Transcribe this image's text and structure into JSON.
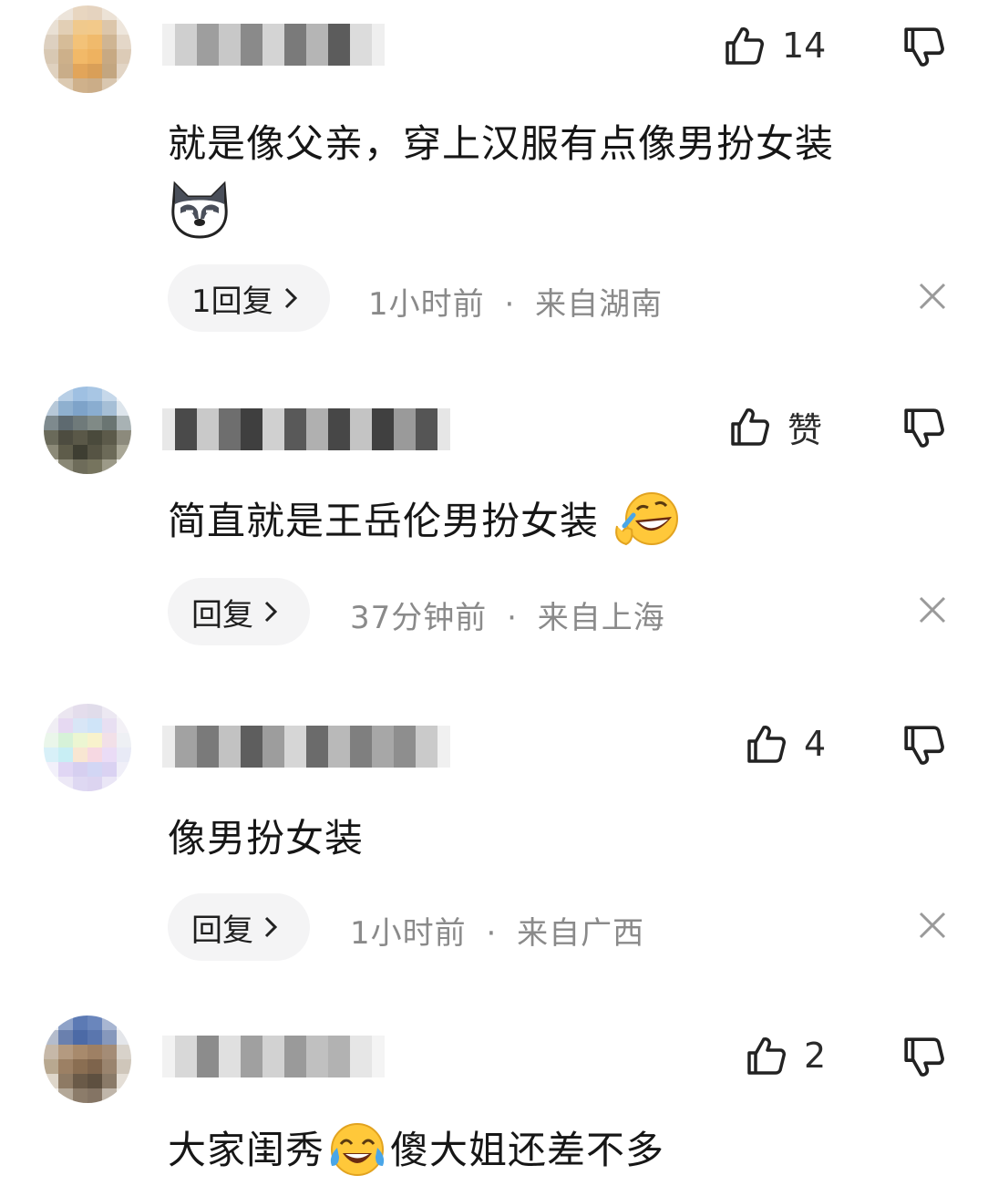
{
  "comments": [
    {
      "likes": "14",
      "text": "就是像父亲，穿上汉服有点像男扮女装",
      "emoji": "husky-emoji",
      "reply_label": "1回复",
      "time": "1小时前",
      "separator": "·",
      "location": "来自湖南"
    },
    {
      "likes": "赞",
      "text": "简直就是王岳伦男扮女装",
      "emoji": "rofl-emoji",
      "reply_label": "回复",
      "time": "37分钟前",
      "separator": "·",
      "location": "来自上海"
    },
    {
      "likes": "4",
      "text": "像男扮女装",
      "reply_label": "回复",
      "time": "1小时前",
      "separator": "·",
      "location": "来自广西"
    },
    {
      "likes": "2",
      "text_before": "大家闺秀",
      "emoji": "tears-of-joy-emoji",
      "text_after": "傻大姐还差不多"
    }
  ],
  "icons": {
    "like": "thumbs-up-icon",
    "dislike": "thumbs-down-icon",
    "close": "close-icon",
    "chevron": "chevron-right-icon"
  },
  "colors": {
    "text_primary": "#161616",
    "text_secondary": "#8a8a8a",
    "pill_bg": "#f4f4f5"
  }
}
